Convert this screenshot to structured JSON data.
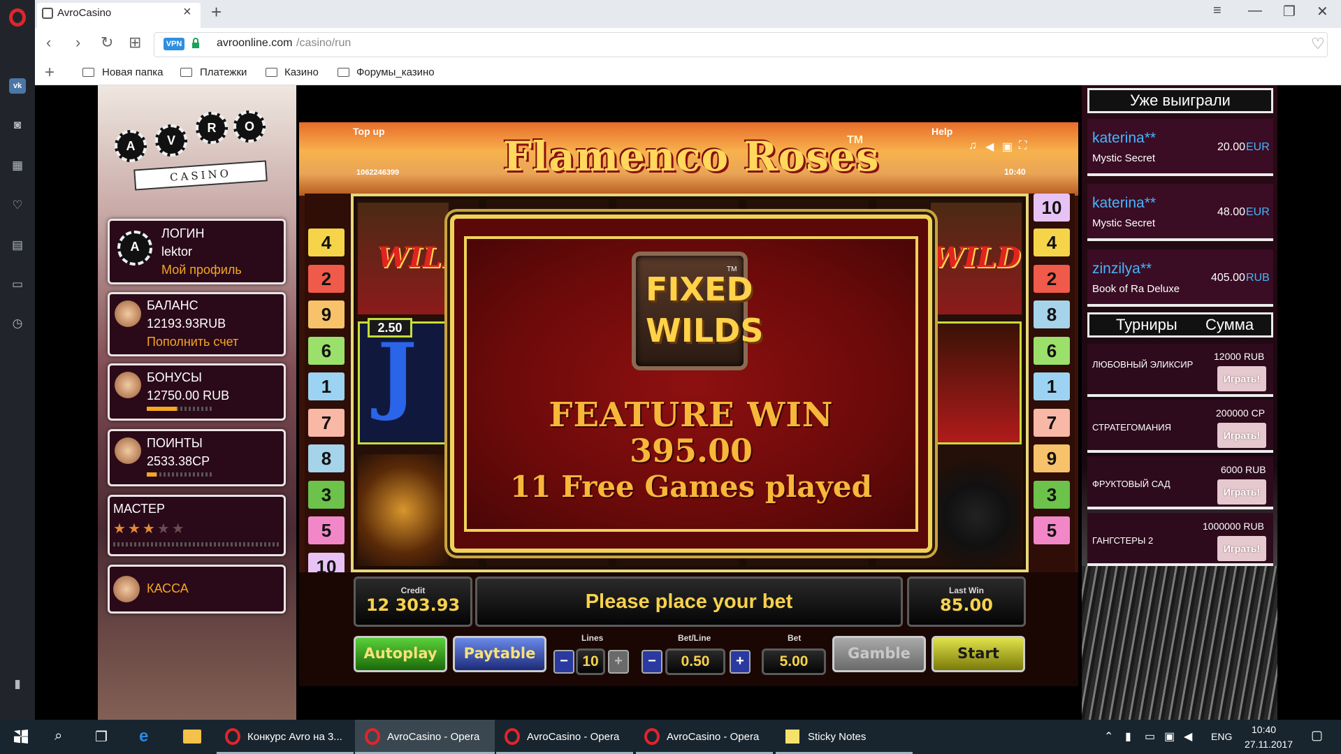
{
  "browser": {
    "tab_title": "AvroCasino",
    "url_host": "avroonline.com",
    "url_path": "/casino/run",
    "vpn_label": "VPN",
    "bookmarks": [
      "Новая папка",
      "Платежки",
      "Казино",
      "Форумы_казино"
    ]
  },
  "left_panel": {
    "logo_letters": [
      "A",
      "V",
      "R",
      "O"
    ],
    "logo_text": "CASINO",
    "login": {
      "title": "ЛОГИН",
      "username": "lektor",
      "link": "Мой профиль"
    },
    "balance": {
      "title": "БАЛАНС",
      "value": "12193.93RUB",
      "link": "Пополнить счет"
    },
    "bonuses": {
      "title": "БОНУСЫ",
      "value": "12750.00 RUB",
      "progress": 0.45
    },
    "points": {
      "title": "ПОИНТЫ",
      "value": "2533.38CP",
      "progress": 0.15
    },
    "master": {
      "title": "МАСТЕР",
      "stars_filled": 3,
      "stars_total": 5
    },
    "cashier": {
      "title": "КАССА"
    }
  },
  "game": {
    "title": "Flamenco Roses",
    "tm": "TM",
    "topup": "Top up",
    "help": "Help",
    "game_id": "1062246399",
    "time": "10:40",
    "paylines_left": [
      "4",
      "2",
      "9",
      "6",
      "1",
      "7",
      "8",
      "3",
      "5",
      "10"
    ],
    "paylines_right": [
      "10",
      "4",
      "2",
      "8",
      "6",
      "1",
      "7",
      "9",
      "3",
      "5"
    ],
    "wild_text": "WILD",
    "line_win_badge": "2.50",
    "symbol_letter": "J",
    "feature": {
      "badge_line1": "FIXED",
      "badge_line2": "WILDS",
      "badge_tm": "TM",
      "title": "FEATURE WIN",
      "amount": "395.00",
      "games_played": "11 Free Games played"
    },
    "credit_label": "Credit",
    "credit_value": "12 303.93",
    "message": "Please place your bet",
    "last_win_label": "Last Win",
    "last_win_value": "85.00",
    "autoplay_label": "Autoplay",
    "paytable_label": "Paytable",
    "lines_label": "Lines",
    "lines_value": "10",
    "betline_label": "Bet/Line",
    "betline_value": "0.50",
    "bet_label": "Bet",
    "bet_value": "5.00",
    "gamble_label": "Gamble",
    "start_label": "Start",
    "minus": "−",
    "plus": "+"
  },
  "right_panel": {
    "winners_header": "Уже выиграли",
    "winners": [
      {
        "name": "katerina**",
        "game": "Mystic Secret",
        "amount": "20.00",
        "currency": "EUR"
      },
      {
        "name": "katerina**",
        "game": "Mystic Secret",
        "amount": "48.00",
        "currency": "EUR"
      },
      {
        "name": "zinzilya**",
        "game": "Book of Ra Deluxe",
        "amount": "405.00",
        "currency": "RUB"
      }
    ],
    "tournaments_header": "Турниры",
    "sum_header": "Сумма",
    "tournaments": [
      {
        "name": "ЛЮБОВНЫЙ ЭЛИКСИР",
        "prize": "12000 RUB",
        "button": "Играть!"
      },
      {
        "name": "СТРАТЕГОМАНИЯ",
        "prize": "200000 CP",
        "button": "Играть!"
      },
      {
        "name": "ФРУКТОВЫЙ САД",
        "prize": "6000 RUB",
        "button": "Играть!"
      },
      {
        "name": "ГАНГСТЕРЫ 2",
        "prize": "1000000 RUB",
        "button": "Играть!"
      }
    ]
  },
  "taskbar": {
    "items": [
      "Конкурс Avro на 3...",
      "AvroCasino - Opera",
      "AvroCasino - Opera",
      "AvroCasino - Opera",
      "Sticky Notes"
    ],
    "lang": "ENG",
    "time": "10:40",
    "date": "27.11.2017"
  },
  "colors": {
    "accent_orange": "#f5a623",
    "winner_blue": "#46b6ff",
    "popup_gold": "#f7b73a",
    "opera_red": "#e0252c"
  }
}
